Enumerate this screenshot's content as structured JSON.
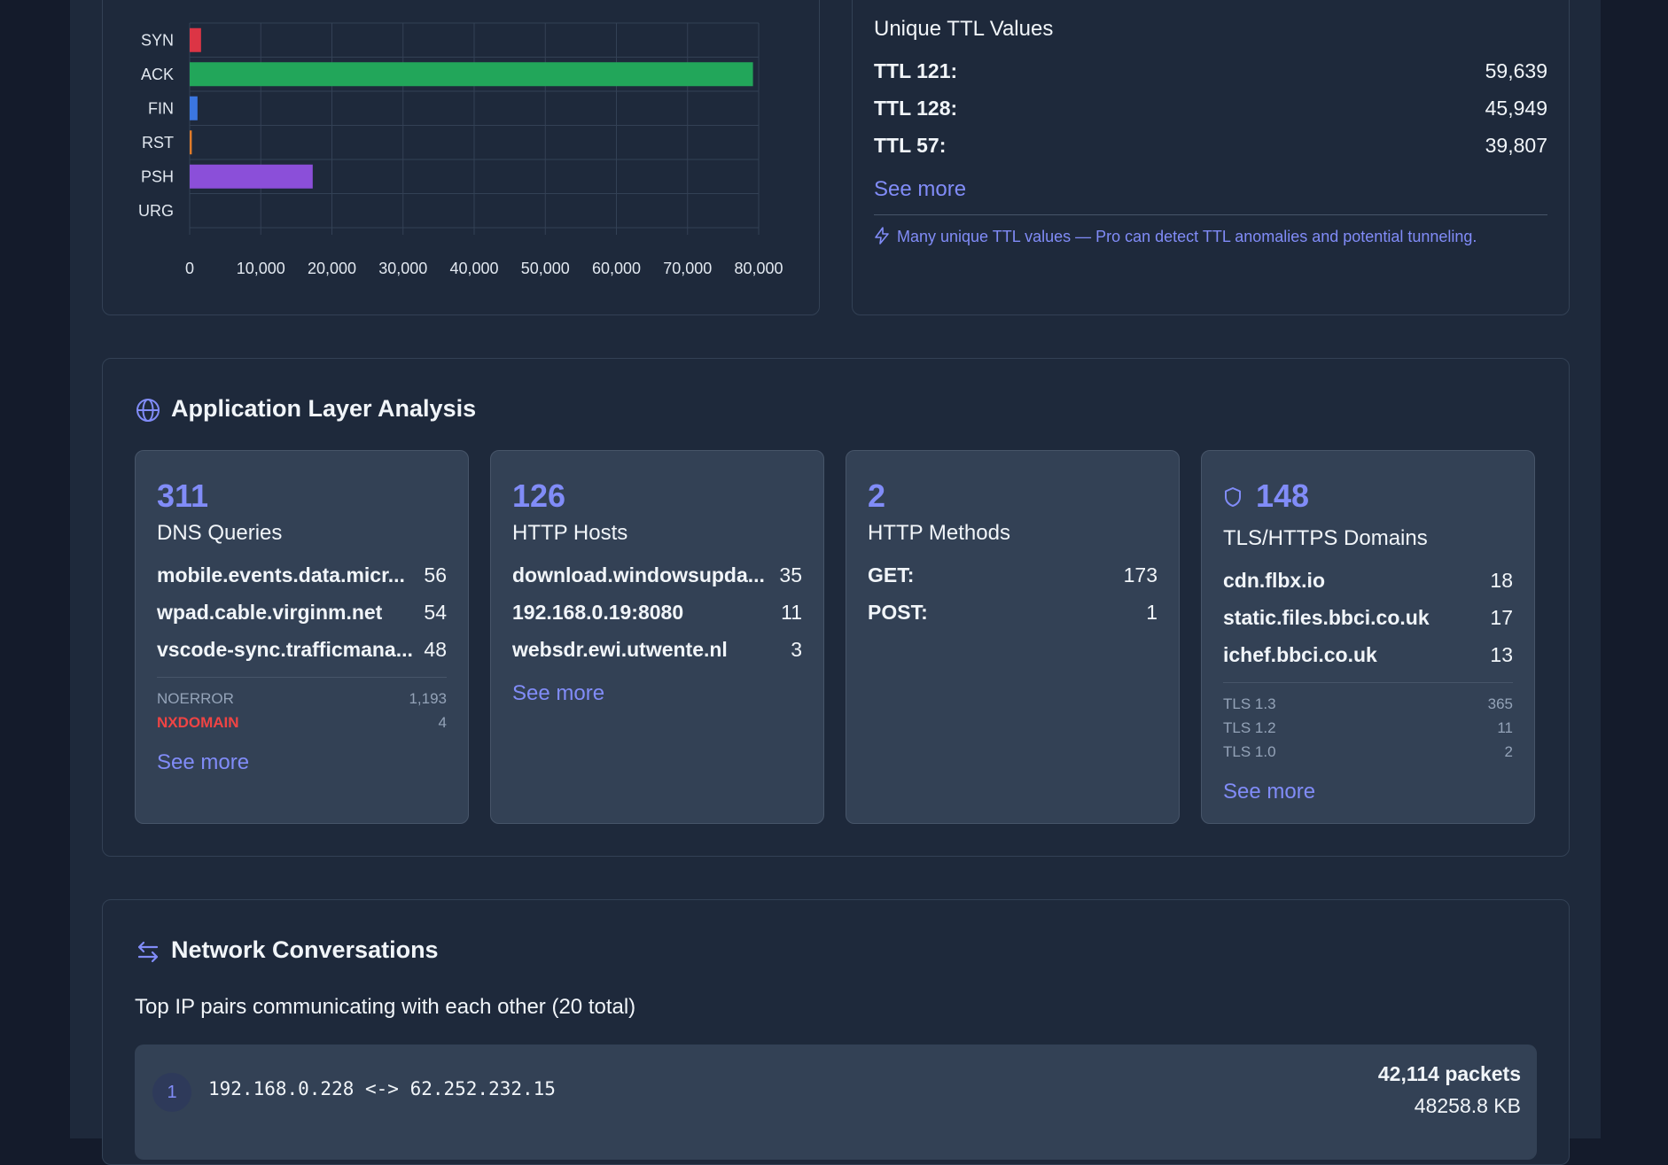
{
  "tcp_flags": {
    "chart_data": {
      "type": "bar",
      "orientation": "horizontal",
      "categories": [
        "SYN",
        "ACK",
        "FIN",
        "RST",
        "PSH",
        "URG"
      ],
      "values": [
        1600,
        79200,
        1100,
        300,
        17300,
        0
      ],
      "colors": [
        "#dc3545",
        "#22a65a",
        "#3b76e0",
        "#e07b2a",
        "#8b4fd9",
        "#6b7280"
      ],
      "xlim": [
        0,
        80000
      ],
      "xticks": [
        "0",
        "10,000",
        "20,000",
        "30,000",
        "40,000",
        "50,000",
        "60,000",
        "70,000",
        "80,000"
      ],
      "grid": true,
      "legend": "none"
    }
  },
  "ttl": {
    "title": "Unique TTL Values",
    "rows": [
      {
        "label": "TTL 121:",
        "value": "59,639"
      },
      {
        "label": "TTL 128:",
        "value": "45,949"
      },
      {
        "label": "TTL 57:",
        "value": "39,807"
      }
    ],
    "see_more": "See more",
    "note": "Many unique TTL values — Pro can detect TTL anomalies and potential tunneling."
  },
  "app": {
    "title": "Application Layer Analysis",
    "dns": {
      "count": "311",
      "label": "DNS Queries",
      "rows": [
        {
          "label": "mobile.events.data.micr...",
          "value": "56"
        },
        {
          "label": "wpad.cable.virginm.net",
          "value": "54"
        },
        {
          "label": "vscode-sync.trafficmana...",
          "value": "48"
        }
      ],
      "codes": [
        {
          "label": "NOERROR",
          "value": "1,193"
        },
        {
          "label": "NXDOMAIN",
          "value": "4"
        }
      ],
      "see_more": "See more"
    },
    "http_hosts": {
      "count": "126",
      "label": "HTTP Hosts",
      "rows": [
        {
          "label": "download.windowsupda...",
          "value": "35"
        },
        {
          "label": "192.168.0.19:8080",
          "value": "11"
        },
        {
          "label": "websdr.ewi.utwente.nl",
          "value": "3"
        }
      ],
      "see_more": "See more"
    },
    "http_methods": {
      "count": "2",
      "label": "HTTP Methods",
      "rows": [
        {
          "label": "GET:",
          "value": "173"
        },
        {
          "label": "POST:",
          "value": "1"
        }
      ]
    },
    "tls": {
      "count": "148",
      "label": "TLS/HTTPS Domains",
      "rows": [
        {
          "label": "cdn.flbx.io",
          "value": "18"
        },
        {
          "label": "static.files.bbci.co.uk",
          "value": "17"
        },
        {
          "label": "ichef.bbci.co.uk",
          "value": "13"
        }
      ],
      "versions": [
        {
          "label": "TLS 1.3",
          "value": "365"
        },
        {
          "label": "TLS 1.2",
          "value": "11"
        },
        {
          "label": "TLS 1.0",
          "value": "2"
        }
      ],
      "see_more": "See more"
    }
  },
  "conversations": {
    "title": "Network Conversations",
    "subtitle": "Top IP pairs communicating with each other (20 total)",
    "items": [
      {
        "rank": "1",
        "pair": "192.168.0.228 <-> 62.252.232.15",
        "packets": "42,114 packets",
        "size": "48258.8 KB"
      }
    ]
  },
  "colors": {
    "accent": "#818cf8",
    "error": "#ef4444"
  }
}
